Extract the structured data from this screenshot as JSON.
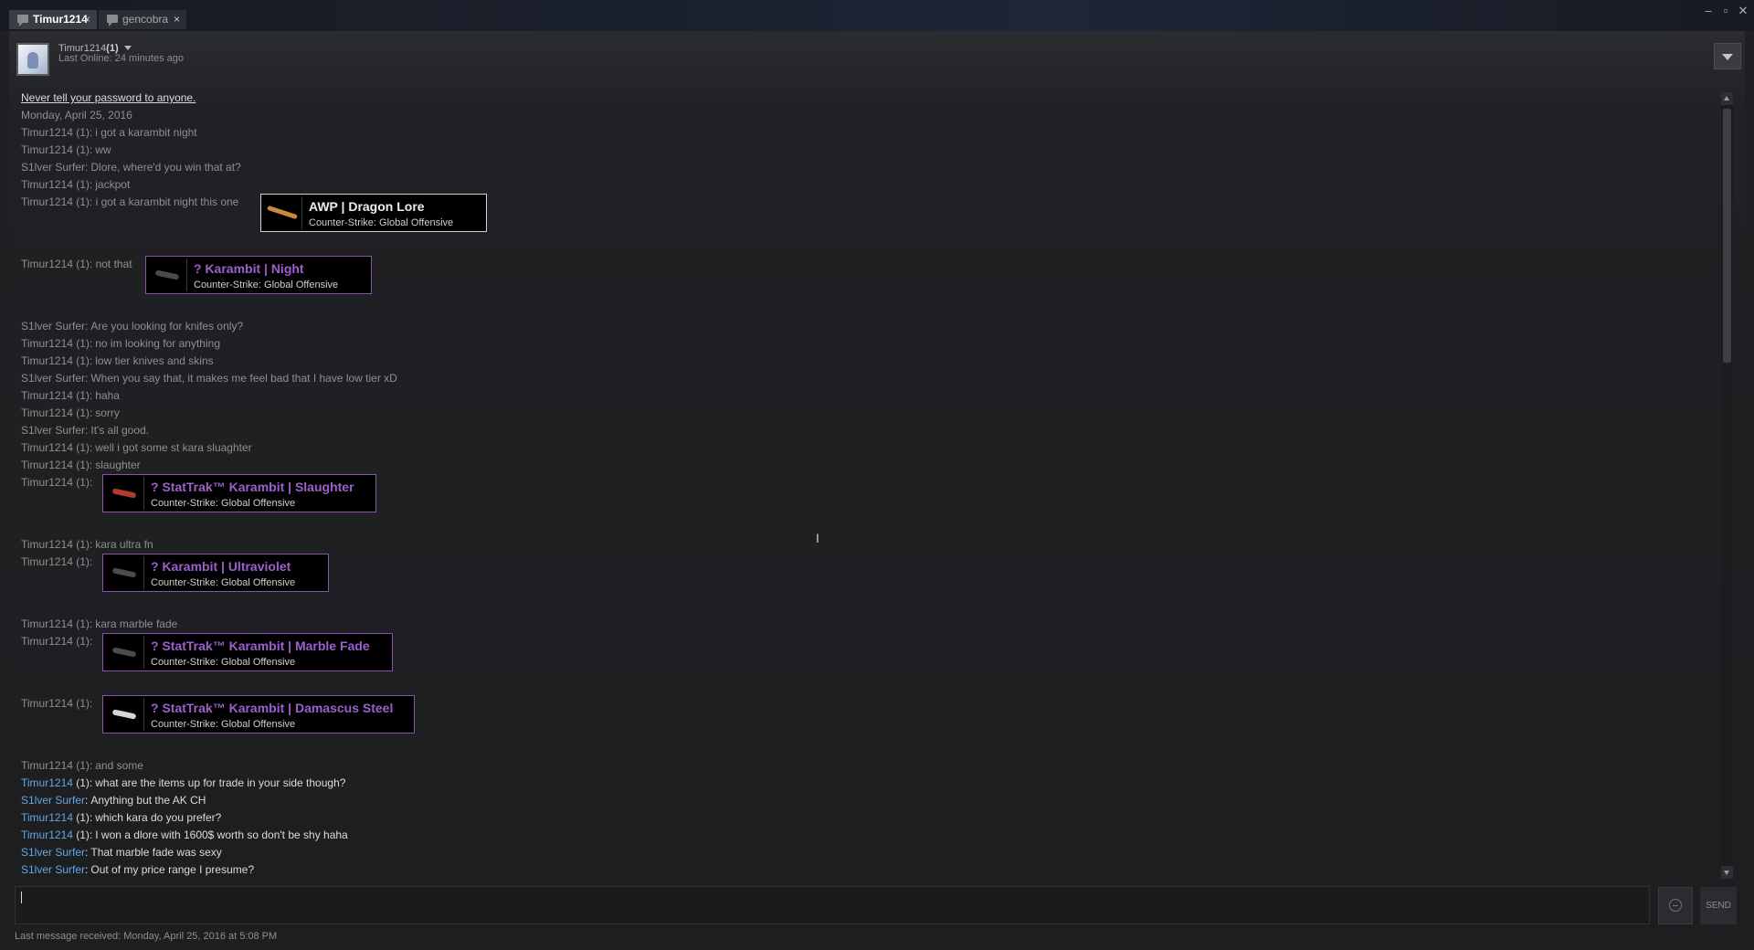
{
  "window": {
    "tabs": [
      {
        "label": "Timur1214",
        "close": "×"
      },
      {
        "label": "gencobra",
        "close": "×"
      }
    ],
    "controls": {
      "minimize": "–",
      "maximize": "▫",
      "close": "✕"
    }
  },
  "header": {
    "friend_name": "Timur1214",
    "friend_suffix": "(1)",
    "last_online": "Last Online: 24 minutes ago"
  },
  "log": {
    "warning": "Never tell your password to anyone.",
    "date": "Monday, April 25, 2016",
    "messages": [
      {
        "sender": "Timur1214 (1):",
        "text": "i got a karambit night"
      },
      {
        "sender": "Timur1214 (1):",
        "text": "ww"
      },
      {
        "sender": "S1lver Surfer:",
        "text": "Dlore, where'd you win that at?"
      },
      {
        "sender": "Timur1214 (1):",
        "text": "jackpot"
      },
      {
        "sender": "S1lver Surfer:",
        "text": "Are you looking for knifes only?"
      },
      {
        "sender": "Timur1214 (1):",
        "text": "no im looking for anything"
      },
      {
        "sender": "Timur1214 (1):",
        "text": "low tier knives and skins"
      },
      {
        "sender": "S1lver Surfer:",
        "text": "When you say that, it makes me feel bad that I have low tier xD"
      },
      {
        "sender": "Timur1214 (1):",
        "text": "haha"
      },
      {
        "sender": "Timur1214 (1):",
        "text": "sorry"
      },
      {
        "sender": "S1lver Surfer:",
        "text": "It's all good."
      },
      {
        "sender": "Timur1214 (1):",
        "text": "well i got some st kara sluaghter"
      },
      {
        "sender": "Timur1214 (1):",
        "text": "slaughter"
      },
      {
        "sender": "Timur1214 (1):",
        "text": "kara ultra fn"
      },
      {
        "sender": "Timur1214 (1):",
        "text": "kara marble fade"
      },
      {
        "sender": "Timur1214 (1):",
        "text": "and some"
      }
    ],
    "embeds": [
      {
        "prefix": "Timur1214 (1): i got a karambit night this one",
        "title": "AWP | Dragon Lore",
        "game": "Counter-Strike: Global Offensive"
      },
      {
        "prefix": "Timur1214 (1): not that",
        "title": "? Karambit | Night",
        "game": "Counter-Strike: Global Offensive"
      },
      {
        "prefix": "Timur1214 (1):",
        "title": "? StatTrak™ Karambit | Slaughter",
        "game": "Counter-Strike: Global Offensive"
      },
      {
        "prefix": "Timur1214 (1):",
        "title": "? Karambit | Ultraviolet",
        "game": "Counter-Strike: Global Offensive"
      },
      {
        "prefix": "Timur1214 (1):",
        "title": "? StatTrak™ Karambit | Marble Fade",
        "game": "Counter-Strike: Global Offensive"
      },
      {
        "prefix": "Timur1214 (1):",
        "title": "? StatTrak™ Karambit | Damascus Steel",
        "game": "Counter-Strike: Global Offensive"
      }
    ],
    "recent": [
      {
        "name": "Timur1214",
        "rest": " (1):",
        "text": "what are the items up for trade in your side though?"
      },
      {
        "name": "S1lver Surfer",
        "rest": ":",
        "text": "Anything but the AK CH"
      },
      {
        "name": "Timur1214",
        "rest": " (1):",
        "text": "which kara do you prefer?"
      },
      {
        "name": "Timur1214",
        "rest": " (1):",
        "text": "I won a dlore with 1600$ worth so don't be shy haha"
      },
      {
        "name": "S1lver Surfer",
        "rest": ":",
        "text": "That marble fade was sexy"
      },
      {
        "name": "S1lver Surfer",
        "rest": ":",
        "text": "Out of my price range I presume?"
      }
    ]
  },
  "input": {
    "value": "",
    "send_label": "SEND"
  },
  "status": {
    "last_received": "Last message received: Monday, April 25, 2016 at 5:08 PM"
  },
  "colors": {
    "link_blue": "#62a7e3",
    "rarity_purple": "#9d5fcc",
    "background": "#1e1f21"
  }
}
